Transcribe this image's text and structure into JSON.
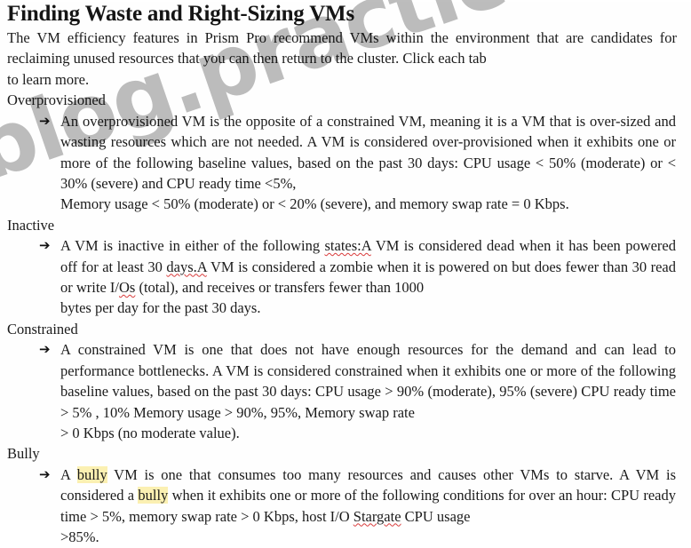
{
  "document": {
    "title": "Finding Waste and Right-Sizing VMs",
    "intro": "The VM efficiency features in Prism Pro recommend VMs within the environment that are candidates for reclaiming unused resources that you can then return to the cluster. Click each tab",
    "intro_last_line": "to learn more."
  },
  "watermark": {
    "text": "blog.practicematerial.com",
    "color": "#b2b2b2"
  },
  "highlight_color": "#fbf0b2",
  "spellcheck_underline_color": "#d93b3b",
  "bullet_glyph": "➔",
  "sections": [
    {
      "heading": "Overprovisioned",
      "highlighted": false,
      "bullet": {
        "part1": "An overprovisioned VM is the opposite of a constrained VM, meaning it is a VM that is over-sized and wasting resources which are not needed. A VM is considered over-provisioned when it exhibits one or more of the following baseline values, based on the past 30 days: CPU usage < 50% (moderate) or < 30% (severe) and CPU ready time <5%,",
        "last_line": "Memory usage < 50% (moderate) or < 20% (severe), and memory swap rate = 0 Kbps."
      }
    },
    {
      "heading": "Inactive",
      "highlighted": false,
      "bullet": {
        "part1": "A VM is inactive in either of the following ",
        "sq1": "states:A",
        "part2": " VM is considered dead when it has been powered off for at least 30 ",
        "sq2": "days.A",
        "part3": " VM is considered a zombie when it is powered on but does fewer than 30 read or write I/",
        "sq3": "Os",
        "part4": " (total), and receives or transfers fewer than 1000",
        "last_line": "bytes per day for the past 30 days."
      }
    },
    {
      "heading": "Constrained",
      "highlighted": false,
      "bullet": {
        "part1": "A constrained VM is one that does not have enough resources for the demand and can lead to performance bottlenecks. A VM is considered constrained when it exhibits one or more of the following baseline values, based on the past 30 days: CPU usage > 90% (moderate), 95% (severe) CPU ready time > 5% , 10% Memory usage > 90%, 95%, Memory swap rate",
        "last_line": "> 0 Kbps (no moderate value)."
      }
    },
    {
      "heading": "Bully",
      "highlighted": true,
      "bullet": {
        "part1": "A ",
        "hl1": "bully",
        "part2": " VM is one that consumes too many resources and causes other VMs to starve. A VM is considered a ",
        "hl2": "bully",
        "part3": " when it exhibits one or more of the following conditions for over an hour: CPU ready time > 5%, memory swap rate > 0 Kbps, host I/O ",
        "sq1": "Stargate",
        "part4": " CPU usage",
        "last_line": ">85%."
      }
    }
  ]
}
